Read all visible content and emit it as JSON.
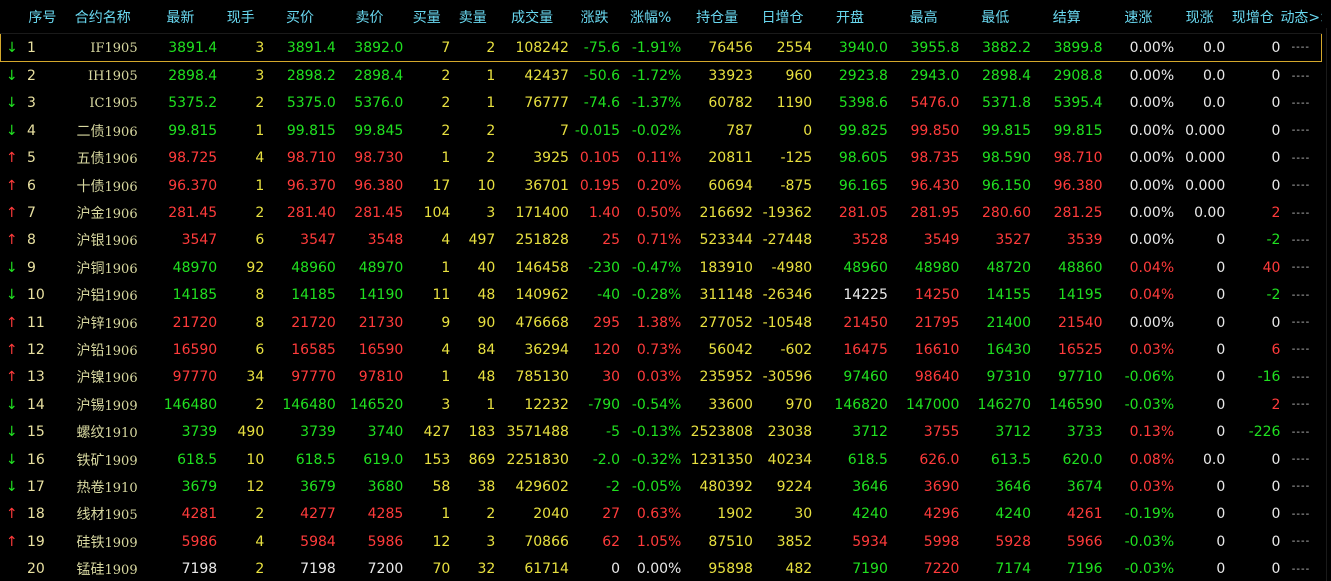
{
  "headers": [
    "",
    "序号",
    "合约名称",
    "最新",
    "现手",
    "买价",
    "卖价",
    "买量",
    "卖量",
    "成交量",
    "涨跌",
    "涨幅%",
    "持仓量",
    "日增仓",
    "开盘",
    "最高",
    "最低",
    "结算",
    "速涨",
    "现涨",
    "现增仓",
    "动态>>"
  ],
  "colors": {
    "up": "#ff3b3b",
    "down": "#20e020",
    "flat": "#eaeaea",
    "volume": "#e8e040",
    "header": "#69d8f0"
  },
  "rows": [
    {
      "arrow": "↓",
      "idx": "1",
      "code": "IF",
      "month": "1905",
      "last": "3891.4",
      "hand": "3",
      "bid": "3891.4",
      "ask": "3892.0",
      "bidv": "7",
      "askv": "2",
      "vol": "108242",
      "chg": "-75.6",
      "pct": "-1.91%",
      "oi": "76456",
      "oichg": "2554",
      "open": "3940.0",
      "high": "3955.8",
      "low": "3882.2",
      "settle": "3899.8",
      "speed": "0.00%",
      "xz": "0.0",
      "xzc": "0",
      "dyn": "----",
      "dir": "down",
      "openc": "down",
      "highc": "down",
      "lowc": "down",
      "settlec": "down",
      "speedc": "wht",
      "xzcc": "wht"
    },
    {
      "arrow": "↓",
      "idx": "2",
      "code": "IH",
      "month": "1905",
      "last": "2898.4",
      "hand": "3",
      "bid": "2898.2",
      "ask": "2898.4",
      "bidv": "2",
      "askv": "1",
      "vol": "42437",
      "chg": "-50.6",
      "pct": "-1.72%",
      "oi": "33923",
      "oichg": "960",
      "open": "2923.8",
      "high": "2943.0",
      "low": "2898.4",
      "settle": "2908.8",
      "speed": "0.00%",
      "xz": "0.0",
      "xzc": "0",
      "dyn": "----",
      "dir": "down",
      "openc": "down",
      "highc": "down",
      "lowc": "down",
      "settlec": "down",
      "speedc": "wht",
      "xzcc": "wht"
    },
    {
      "arrow": "↓",
      "idx": "3",
      "code": "IC",
      "month": "1905",
      "last": "5375.2",
      "hand": "2",
      "bid": "5375.0",
      "ask": "5376.0",
      "bidv": "2",
      "askv": "1",
      "vol": "76777",
      "chg": "-74.6",
      "pct": "-1.37%",
      "oi": "60782",
      "oichg": "1190",
      "open": "5398.6",
      "high": "5476.0",
      "low": "5371.8",
      "settle": "5395.4",
      "speed": "0.00%",
      "xz": "0.0",
      "xzc": "0",
      "dyn": "----",
      "dir": "down",
      "openc": "down",
      "highc": "up",
      "lowc": "down",
      "settlec": "down",
      "speedc": "wht",
      "xzcc": "wht"
    },
    {
      "arrow": "↓",
      "idx": "4",
      "code": "二债",
      "month": "1906",
      "last": "99.815",
      "hand": "1",
      "bid": "99.815",
      "ask": "99.845",
      "bidv": "2",
      "askv": "2",
      "vol": "7",
      "chg": "-0.015",
      "pct": "-0.02%",
      "oi": "787",
      "oichg": "0",
      "open": "99.825",
      "high": "99.850",
      "low": "99.815",
      "settle": "99.815",
      "speed": "0.00%",
      "xz": "0.000",
      "xzc": "0",
      "dyn": "----",
      "dir": "down",
      "openc": "down",
      "highc": "up",
      "lowc": "down",
      "settlec": "down",
      "speedc": "wht",
      "xzcc": "wht"
    },
    {
      "arrow": "↑",
      "idx": "5",
      "code": "五债",
      "month": "1906",
      "last": "98.725",
      "hand": "4",
      "bid": "98.710",
      "ask": "98.730",
      "bidv": "1",
      "askv": "2",
      "vol": "3925",
      "chg": "0.105",
      "pct": "0.11%",
      "oi": "20811",
      "oichg": "-125",
      "open": "98.605",
      "high": "98.735",
      "low": "98.590",
      "settle": "98.710",
      "speed": "0.00%",
      "xz": "0.000",
      "xzc": "0",
      "dyn": "----",
      "dir": "up",
      "openc": "down",
      "highc": "up",
      "lowc": "down",
      "settlec": "up",
      "speedc": "wht",
      "xzcc": "wht"
    },
    {
      "arrow": "↑",
      "idx": "6",
      "code": "十债",
      "month": "1906",
      "last": "96.370",
      "hand": "1",
      "bid": "96.370",
      "ask": "96.380",
      "bidv": "17",
      "askv": "10",
      "vol": "36701",
      "chg": "0.195",
      "pct": "0.20%",
      "oi": "60694",
      "oichg": "-875",
      "open": "96.165",
      "high": "96.430",
      "low": "96.150",
      "settle": "96.380",
      "speed": "0.00%",
      "xz": "0.000",
      "xzc": "0",
      "dyn": "----",
      "dir": "up",
      "openc": "down",
      "highc": "up",
      "lowc": "down",
      "settlec": "up",
      "speedc": "wht",
      "xzcc": "wht"
    },
    {
      "arrow": "↑",
      "idx": "7",
      "code": "沪金",
      "month": "1906",
      "last": "281.45",
      "hand": "2",
      "bid": "281.40",
      "ask": "281.45",
      "bidv": "104",
      "askv": "3",
      "vol": "171400",
      "chg": "1.40",
      "pct": "0.50%",
      "oi": "216692",
      "oichg": "-19362",
      "open": "281.05",
      "high": "281.95",
      "low": "280.60",
      "settle": "281.25",
      "speed": "0.00%",
      "xz": "0.00",
      "xzc": "2",
      "dyn": "----",
      "dir": "up",
      "openc": "up",
      "highc": "up",
      "lowc": "up",
      "settlec": "up",
      "speedc": "wht",
      "xzcc": "up"
    },
    {
      "arrow": "↑",
      "idx": "8",
      "code": "沪银",
      "month": "1906",
      "last": "3547",
      "hand": "6",
      "bid": "3547",
      "ask": "3548",
      "bidv": "4",
      "askv": "497",
      "vol": "251828",
      "chg": "25",
      "pct": "0.71%",
      "oi": "523344",
      "oichg": "-27448",
      "open": "3528",
      "high": "3549",
      "low": "3527",
      "settle": "3539",
      "speed": "0.00%",
      "xz": "0",
      "xzc": "-2",
      "dyn": "----",
      "dir": "up",
      "openc": "up",
      "highc": "up",
      "lowc": "up",
      "settlec": "up",
      "speedc": "wht",
      "xzcc": "down"
    },
    {
      "arrow": "↓",
      "idx": "9",
      "code": "沪铜",
      "month": "1906",
      "last": "48970",
      "hand": "92",
      "bid": "48960",
      "ask": "48970",
      "bidv": "1",
      "askv": "40",
      "vol": "146458",
      "chg": "-230",
      "pct": "-0.47%",
      "oi": "183910",
      "oichg": "-4980",
      "open": "48960",
      "high": "48980",
      "low": "48720",
      "settle": "48860",
      "speed": "0.04%",
      "xz": "0",
      "xzc": "40",
      "dyn": "----",
      "dir": "down",
      "openc": "down",
      "highc": "down",
      "lowc": "down",
      "settlec": "down",
      "speedc": "up",
      "xzcc": "up"
    },
    {
      "arrow": "↓",
      "idx": "10",
      "code": "沪铝",
      "month": "1906",
      "last": "14185",
      "hand": "8",
      "bid": "14185",
      "ask": "14190",
      "bidv": "11",
      "askv": "48",
      "vol": "140962",
      "chg": "-40",
      "pct": "-0.28%",
      "oi": "311148",
      "oichg": "-26346",
      "open": "14225",
      "high": "14250",
      "low": "14155",
      "settle": "14195",
      "speed": "0.04%",
      "xz": "0",
      "xzc": "-2",
      "dyn": "----",
      "dir": "down",
      "openc": "flat",
      "highc": "up",
      "lowc": "down",
      "settlec": "down",
      "speedc": "up",
      "xzcc": "down"
    },
    {
      "arrow": "↑",
      "idx": "11",
      "code": "沪锌",
      "month": "1906",
      "last": "21720",
      "hand": "8",
      "bid": "21720",
      "ask": "21730",
      "bidv": "9",
      "askv": "90",
      "vol": "476668",
      "chg": "295",
      "pct": "1.38%",
      "oi": "277052",
      "oichg": "-10548",
      "open": "21450",
      "high": "21795",
      "low": "21400",
      "settle": "21540",
      "speed": "0.00%",
      "xz": "0",
      "xzc": "0",
      "dyn": "----",
      "dir": "up",
      "openc": "up",
      "highc": "up",
      "lowc": "down",
      "settlec": "up",
      "speedc": "wht",
      "xzcc": "wht"
    },
    {
      "arrow": "↑",
      "idx": "12",
      "code": "沪铅",
      "month": "1906",
      "last": "16590",
      "hand": "6",
      "bid": "16585",
      "ask": "16590",
      "bidv": "4",
      "askv": "84",
      "vol": "36294",
      "chg": "120",
      "pct": "0.73%",
      "oi": "56042",
      "oichg": "-602",
      "open": "16475",
      "high": "16610",
      "low": "16430",
      "settle": "16525",
      "speed": "0.03%",
      "xz": "0",
      "xzc": "6",
      "dyn": "----",
      "dir": "up",
      "openc": "up",
      "highc": "up",
      "lowc": "down",
      "settlec": "up",
      "speedc": "up",
      "xzcc": "up"
    },
    {
      "arrow": "↑",
      "idx": "13",
      "code": "沪镍",
      "month": "1906",
      "last": "97770",
      "hand": "34",
      "bid": "97770",
      "ask": "97810",
      "bidv": "1",
      "askv": "48",
      "vol": "785130",
      "chg": "30",
      "pct": "0.03%",
      "oi": "235952",
      "oichg": "-30596",
      "open": "97460",
      "high": "98640",
      "low": "97310",
      "settle": "97710",
      "speed": "-0.06%",
      "xz": "0",
      "xzc": "-16",
      "dyn": "----",
      "dir": "up",
      "openc": "down",
      "highc": "up",
      "lowc": "down",
      "settlec": "down",
      "speedc": "down",
      "xzcc": "down"
    },
    {
      "arrow": "↓",
      "idx": "14",
      "code": "沪锡",
      "month": "1909",
      "last": "146480",
      "hand": "2",
      "bid": "146480",
      "ask": "146520",
      "bidv": "3",
      "askv": "1",
      "vol": "12232",
      "chg": "-790",
      "pct": "-0.54%",
      "oi": "33600",
      "oichg": "970",
      "open": "146820",
      "high": "147000",
      "low": "146270",
      "settle": "146590",
      "speed": "-0.03%",
      "xz": "0",
      "xzc": "2",
      "dyn": "----",
      "dir": "down",
      "openc": "down",
      "highc": "down",
      "lowc": "down",
      "settlec": "down",
      "speedc": "down",
      "xzcc": "up"
    },
    {
      "arrow": "↓",
      "idx": "15",
      "code": "螺纹",
      "month": "1910",
      "last": "3739",
      "hand": "490",
      "bid": "3739",
      "ask": "3740",
      "bidv": "427",
      "askv": "183",
      "vol": "3571488",
      "chg": "-5",
      "pct": "-0.13%",
      "oi": "2523808",
      "oichg": "23038",
      "open": "3712",
      "high": "3755",
      "low": "3712",
      "settle": "3733",
      "speed": "0.13%",
      "xz": "0",
      "xzc": "-226",
      "dyn": "----",
      "dir": "down",
      "openc": "down",
      "highc": "up",
      "lowc": "down",
      "settlec": "down",
      "speedc": "up",
      "xzcc": "down"
    },
    {
      "arrow": "↓",
      "idx": "16",
      "code": "铁矿",
      "month": "1909",
      "last": "618.5",
      "hand": "10",
      "bid": "618.5",
      "ask": "619.0",
      "bidv": "153",
      "askv": "869",
      "vol": "2251830",
      "chg": "-2.0",
      "pct": "-0.32%",
      "oi": "1231350",
      "oichg": "40234",
      "open": "618.5",
      "high": "626.0",
      "low": "613.5",
      "settle": "620.0",
      "speed": "0.08%",
      "xz": "0.0",
      "xzc": "0",
      "dyn": "----",
      "dir": "down",
      "openc": "down",
      "highc": "up",
      "lowc": "down",
      "settlec": "down",
      "speedc": "up",
      "xzcc": "wht"
    },
    {
      "arrow": "↓",
      "idx": "17",
      "code": "热卷",
      "month": "1910",
      "last": "3679",
      "hand": "12",
      "bid": "3679",
      "ask": "3680",
      "bidv": "58",
      "askv": "38",
      "vol": "429602",
      "chg": "-2",
      "pct": "-0.05%",
      "oi": "480392",
      "oichg": "9224",
      "open": "3646",
      "high": "3690",
      "low": "3646",
      "settle": "3674",
      "speed": "0.03%",
      "xz": "0",
      "xzc": "0",
      "dyn": "----",
      "dir": "down",
      "openc": "down",
      "highc": "up",
      "lowc": "down",
      "settlec": "down",
      "speedc": "up",
      "xzcc": "wht"
    },
    {
      "arrow": "↑",
      "idx": "18",
      "code": "线材",
      "month": "1905",
      "last": "4281",
      "hand": "2",
      "bid": "4277",
      "ask": "4285",
      "bidv": "1",
      "askv": "2",
      "vol": "2040",
      "chg": "27",
      "pct": "0.63%",
      "oi": "1902",
      "oichg": "30",
      "open": "4240",
      "high": "4296",
      "low": "4240",
      "settle": "4261",
      "speed": "-0.19%",
      "xz": "0",
      "xzc": "0",
      "dyn": "----",
      "dir": "up",
      "openc": "down",
      "highc": "up",
      "lowc": "down",
      "settlec": "up",
      "speedc": "down",
      "xzcc": "wht"
    },
    {
      "arrow": "↑",
      "idx": "19",
      "code": "硅铁",
      "month": "1909",
      "last": "5986",
      "hand": "4",
      "bid": "5984",
      "ask": "5986",
      "bidv": "12",
      "askv": "3",
      "vol": "70866",
      "chg": "62",
      "pct": "1.05%",
      "oi": "87510",
      "oichg": "3852",
      "open": "5934",
      "high": "5998",
      "low": "5928",
      "settle": "5966",
      "speed": "-0.03%",
      "xz": "0",
      "xzc": "0",
      "dyn": "----",
      "dir": "up",
      "openc": "up",
      "highc": "up",
      "lowc": "up",
      "settlec": "up",
      "speedc": "down",
      "xzcc": "wht"
    },
    {
      "arrow": "",
      "idx": "20",
      "code": "锰硅",
      "month": "1909",
      "last": "7198",
      "hand": "2",
      "bid": "7198",
      "ask": "7200",
      "bidv": "70",
      "askv": "32",
      "vol": "61714",
      "chg": "0",
      "pct": "0.00%",
      "oi": "95898",
      "oichg": "482",
      "open": "7190",
      "high": "7220",
      "low": "7174",
      "settle": "7196",
      "speed": "-0.03%",
      "xz": "0",
      "xzc": "0",
      "dyn": "----",
      "dir": "flat",
      "openc": "down",
      "highc": "up",
      "lowc": "down",
      "settlec": "down",
      "speedc": "down",
      "xzcc": "wht"
    }
  ]
}
